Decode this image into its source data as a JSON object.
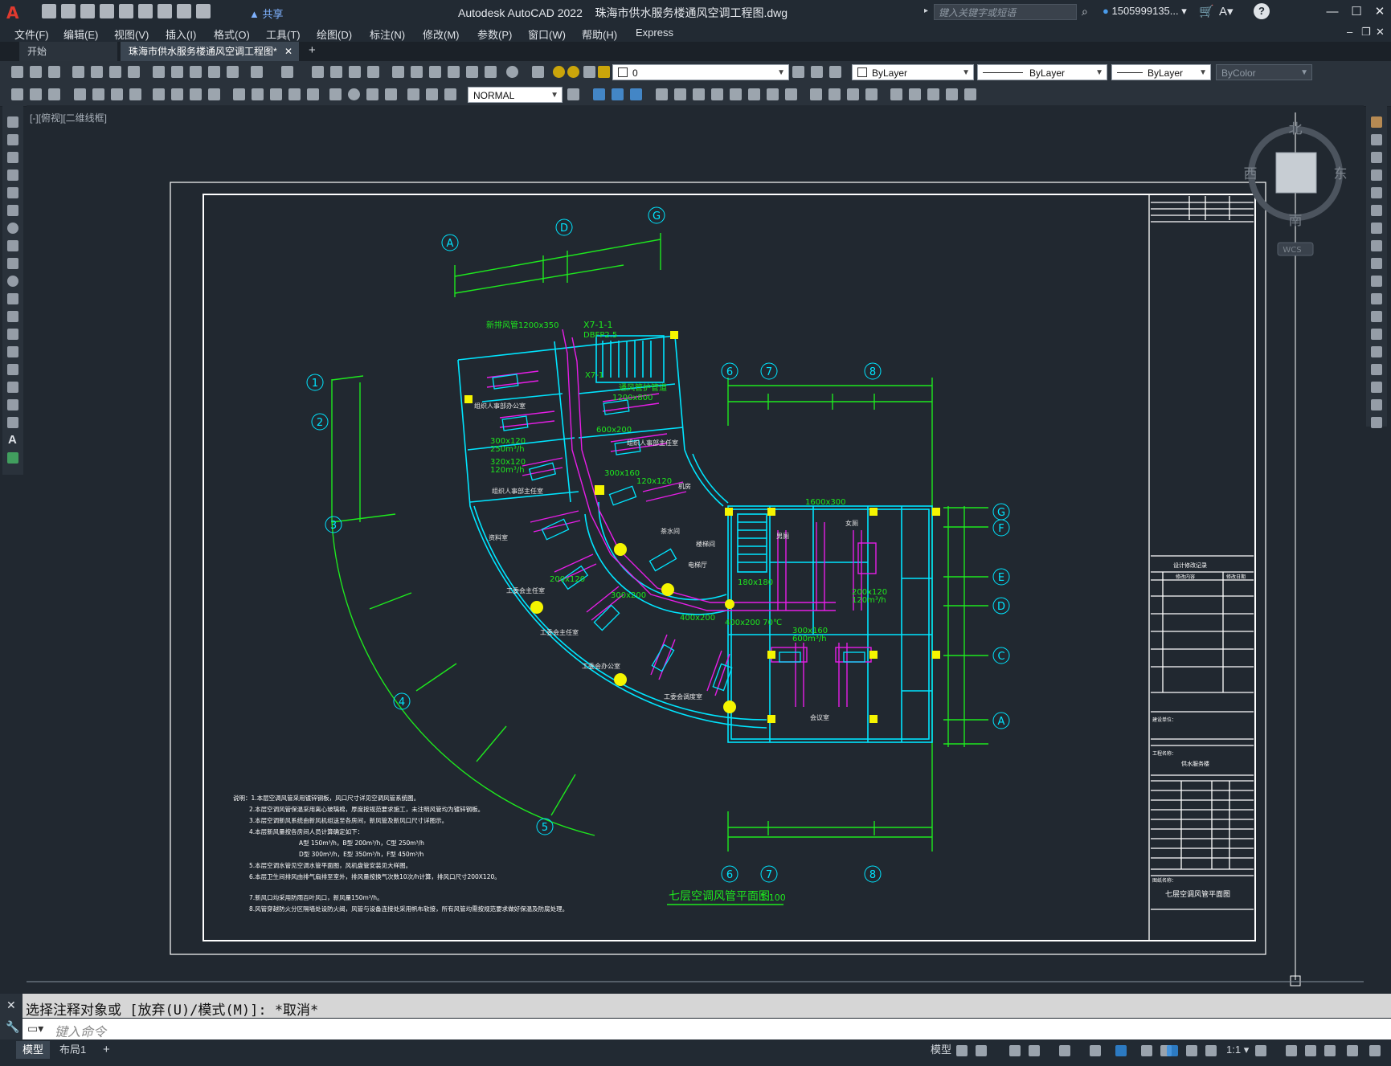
{
  "app": {
    "title": "Autodesk AutoCAD 2022",
    "filename": "珠海市供水服务楼通风空调工程图.dwg",
    "share_label": "共享",
    "search_placeholder": "键入关键字或短语",
    "user": "1505999135...",
    "help_icon": "?"
  },
  "menu": [
    "文件(F)",
    "编辑(E)",
    "视图(V)",
    "插入(I)",
    "格式(O)",
    "工具(T)",
    "绘图(D)",
    "标注(N)",
    "修改(M)",
    "参数(P)",
    "窗口(W)",
    "帮助(H)",
    "Express"
  ],
  "tabs": [
    {
      "label": "开始"
    },
    {
      "label": "珠海市供水服务楼通风空调工程图*"
    }
  ],
  "toolbar": {
    "layer_value": "0",
    "linetype": "ByLayer",
    "lineweight1": "ByLayer",
    "lineweight2": "ByLayer",
    "plotstyle": "ByColor",
    "dimstyle": "NORMAL"
  },
  "viewport": {
    "label": "[-][俯视][二维线框]",
    "compass": {
      "north": "北",
      "south": "南",
      "east": "东",
      "west": "西",
      "ucs": "WCS"
    }
  },
  "drawing": {
    "plan_title": "七层空调风管平面图",
    "scale": "1:100",
    "grid_bubbles_arc": [
      "1",
      "2",
      "3",
      "4",
      "5"
    ],
    "grid_bubbles_top": [
      "A",
      "D",
      "G"
    ],
    "grid_bubbles_right_top": [
      "6",
      "7",
      "8"
    ],
    "grid_bubbles_right_side": [
      "G",
      "F",
      "E",
      "D",
      "C",
      "A"
    ],
    "grid_bubbles_bottom": [
      "6",
      "7",
      "8"
    ],
    "duct_labels": [
      "新排风管1200x350",
      "X7-1-1",
      "DBFP2.5",
      "X7-1",
      "通风管护管道",
      "1200x800",
      "600x200",
      "300x120",
      "250m³/h",
      "320x120",
      "120m³/h",
      "200x120",
      "300x160",
      "120x120",
      "400x200",
      "300x200",
      "180x180",
      "1600x300",
      "200x120",
      "120m³/h",
      "300x160",
      "600m³/h",
      "400x200 70℃"
    ],
    "room_labels": [
      "组织人事部办公室",
      "组织人事部主任室",
      "组织人事部主任室",
      "资料室",
      "工委会主任室",
      "工委会主任室",
      "工委会办公室",
      "工委会调度室",
      "电梯厅",
      "机房",
      "楼梯间",
      "会议室",
      "男厕",
      "女厕",
      "茶水间"
    ],
    "notes": [
      "说明：1.本层空调风管采用镀锌钢板，风口尺寸详见空调风管系统图。",
      "2.本层空调风管保温采用离心玻璃棉，厚度按规范要求施工，未注明风管均为镀锌钢板。",
      "3.本层空调新风系统由新风机组送至各房间，新风管及新风口尺寸详图示。",
      "4.本层新风量按各房间人员计算确定如下：",
      "A型 150m³/h，B型 200m³/h，C型 250m³/h",
      "D型 300m³/h，E型 350m³/h，F型 450m³/h",
      "5.本层空调水管见空调水管平面图，风机盘管安装见大样图。",
      "6.本层卫生间排风由排气扇排至室外，排风量按换气次数10次/h计算，排风口尺寸200X120。",
      "7.新风口均采用防雨百叶风口，新风量150m³/h。",
      "8.风管穿越防火分区隔墙处设防火阀，风管与设备连接处采用帆布软接，所有风管均需按规范要求做好保温及防腐处理。"
    ]
  },
  "titleblock": {
    "revisions": "设计修改记录",
    "rev_content": "修改内容",
    "rev_date": "修改日期",
    "owner": "建设单位：",
    "project_label": "工程名称：",
    "project": "供水服务楼",
    "drawing_label": "图纸名称：",
    "drawing_name": "七层空调风管平面图"
  },
  "command": {
    "history": "选择注释对象或 [放弃(U)/模式(M)]: *取消*",
    "prompt": "键入命令"
  },
  "status": {
    "tabs": [
      "模型",
      "布局1"
    ],
    "model_label": "模型",
    "scale": "1:1"
  },
  "colors": {
    "background": "#212830",
    "cyan": "#00e5ff",
    "green": "#1ee81e",
    "magenta": "#e61ee6",
    "yellow": "#f5f500",
    "white": "#ffffff",
    "accent": "#e03a2f"
  }
}
